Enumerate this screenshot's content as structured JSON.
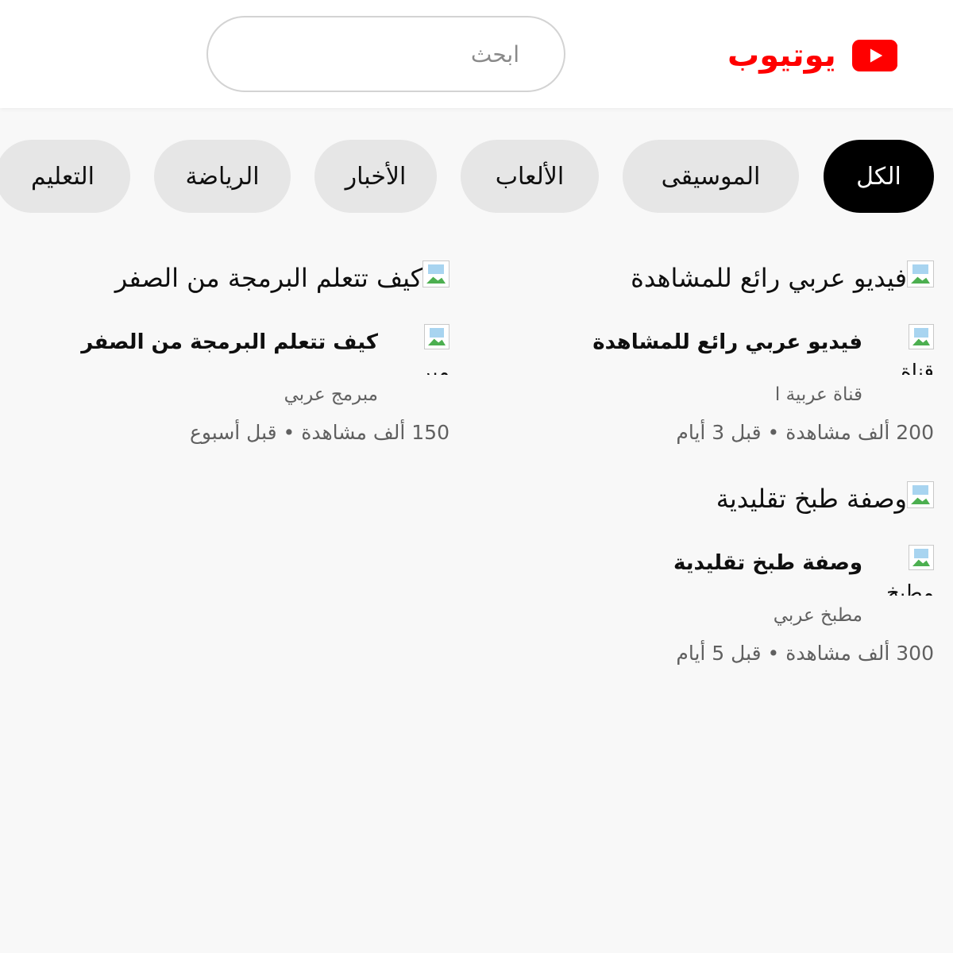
{
  "header": {
    "logo_text": "يوتيوب",
    "search_placeholder": "ابحث",
    "brand_color": "#ff0000"
  },
  "chips": [
    {
      "label": "الكل",
      "active": true
    },
    {
      "label": "الموسيقى",
      "active": false
    },
    {
      "label": "الألعاب",
      "active": false
    },
    {
      "label": "الأخبار",
      "active": false
    },
    {
      "label": "الرياضة",
      "active": false
    },
    {
      "label": "التعليم",
      "active": false
    }
  ],
  "videos": [
    {
      "thumbnail_alt": "فيديو عربي رائع للمشاهدة",
      "avatar_alt": "قناة",
      "title": "فيديو عربي رائع للمشاهدة",
      "channel": "قناة عربية ا",
      "meta": "200 ألف مشاهدة • قبل 3 أيام"
    },
    {
      "thumbnail_alt": "كيف تتعلم البرمجة من الصفر",
      "avatar_alt": "مبر",
      "title": "كيف تتعلم البرمجة من الصفر",
      "channel": "مبرمج عربي",
      "meta": "150 ألف مشاهدة • قبل أسبوع"
    },
    {
      "thumbnail_alt": "وصفة طبخ تقليدية",
      "avatar_alt": "مطبخ",
      "title": "وصفة طبخ تقليدية",
      "channel": "مطبخ عربي",
      "meta": "300 ألف مشاهدة • قبل 5 أيام"
    }
  ]
}
